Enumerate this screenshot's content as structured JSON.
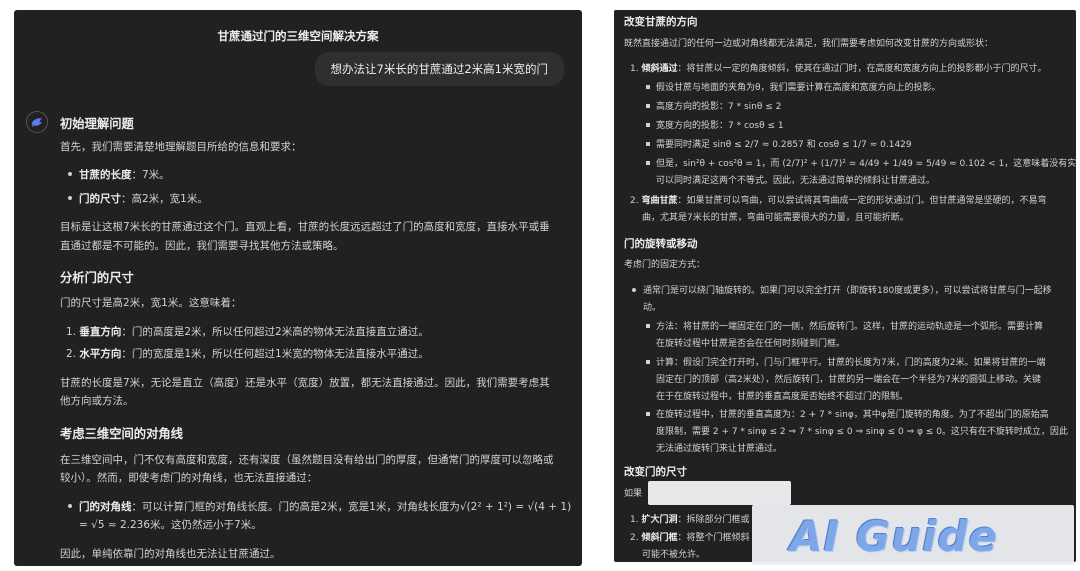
{
  "left": {
    "title": "甘蔗通过门的三维空间解决方案",
    "user_message": "想办法让7米长的甘蔗通过2米高1米宽的门",
    "h1": "初始理解问题",
    "p1": "首先，我们需要清楚地理解题目所给的信息和要求：",
    "b1_label": "甘蔗的长度",
    "b1_text": "：7米。",
    "b2_label": "门的尺寸",
    "b2_text": "：高2米，宽1米。",
    "p2_l1": "目标是让这根7米长的甘蔗通过这个门。直观上看，甘蔗的长度远远超过了门的高度和宽度，直接水平或垂",
    "p2_l2": "直通过都是不可能的。因此，我们需要寻找其他方法或策略。",
    "h2": "分析门的尺寸",
    "p3": "门的尺寸是高2米，宽1米。这意味着：",
    "n1_num": "1.",
    "n1_label": "垂直方向",
    "n1_text": "：门的高度是2米，所以任何超过2米高的物体无法直接直立通过。",
    "n2_num": "2.",
    "n2_label": "水平方向",
    "n2_text": "：门的宽度是1米，所以任何超过1米宽的物体无法直接水平通过。",
    "p4_l1": "甘蔗的长度是7米，无论是直立（高度）还是水平（宽度）放置，都无法直接通过。因此，我们需要考虑其",
    "p4_l2": "他方向或方法。",
    "h3": "考虑三维空间的对角线",
    "p5_l1": "在三维空间中，门不仅有高度和宽度，还有深度（虽然题目没有给出门的厚度，但通常门的厚度可以忽略或",
    "p5_l2": "较小）。然而，即使考虑门的对角线，也无法直接通过：",
    "b3_label": "门的对角线",
    "b3_text": "：可以计算门框的对角线长度。门的高是2米，宽是1米，对角线长度为√(2² + 1²) = √(4 + 1)",
    "b3_l2": "= √5 ≈ 2.236米。这仍然远小于7米。",
    "p6": "因此，单纯依靠门的对角线也无法让甘蔗通过。"
  },
  "right": {
    "h1": "改变甘蔗的方向",
    "p1": "既然直接通过门的任何一边或对角线都无法满足，我们需要考虑如何改变甘蔗的方向或形状：",
    "n1_num": "1.",
    "n1_label": "倾斜通过",
    "n1_text": "：将甘蔗以一定的角度倾斜，使其在通过门时，在高度和宽度方向上的投影都小于门的尺寸。",
    "s1": "假设甘蔗与地面的夹角为θ，我们需要计算在高度和宽度方向上的投影。",
    "s2": "高度方向的投影：7 * sinθ ≤ 2",
    "s3": "宽度方向的投影：7 * cosθ ≤ 1",
    "s4": "需要同时满足 sinθ ≤ 2/7 ≈ 0.2857 和 cosθ ≤ 1/7 ≈ 0.1429",
    "s5_l1": "但是，sin²θ + cos²θ = 1，而 (2/7)² + (1/7)² = 4/49 + 1/49 = 5/49 ≈ 0.102 < 1，这意味着没有实数θ",
    "s5_l2": "可以同时满足这两个不等式。因此，无法通过简单的倾斜让甘蔗通过。",
    "n2_num": "2.",
    "n2_label": "弯曲甘蔗",
    "n2_text": "：如果甘蔗可以弯曲，可以尝试将其弯曲成一定的形状通过门。但甘蔗通常是坚硬的，不易弯",
    "n2_l2": "曲，尤其是7米长的甘蔗，弯曲可能需要很大的力量，且可能折断。",
    "h2": "门的旋转或移动",
    "p2": "考虑门的固定方式：",
    "b1_l1": "通常门是可以绕门轴旋转的。如果门可以完全打开（即旋转180度或更多），可以尝试将甘蔗与门一起移",
    "b1_l2": "动。",
    "m1_l1": "方法：将甘蔗的一端固定在门的一侧，然后旋转门。这样，甘蔗的运动轨迹是一个弧形。需要计算",
    "m1_l2": "在旋转过程中甘蔗是否会在任何时刻碰到门框。",
    "m2_l1": "计算：假设门完全打开时，门与门框平行。甘蔗的长度为7米，门的高度为2米。如果将甘蔗的一端",
    "m2_l2": "固定在门的顶部（高2米处），然后旋转门，甘蔗的另一端会在一个半径为7米的圆弧上移动。关键",
    "m2_l3": "在于在旋转过程中，甘蔗的垂直高度是否始终不超过门的限制。",
    "m3_l1": "在旋转过程中，甘蔗的垂直高度为：2 + 7 * sinφ，其中φ是门旋转的角度。为了不超出门的原始高",
    "m3_l2": "度限制，需要 2 + 7 * sinφ ≤ 2 ⇒ 7 * sinφ ≤ 0 ⇒ sinφ ≤ 0 ⇒ φ ≤ 0。这只有在不旋转时成立，因此",
    "m3_l3": "无法通过旋转门来让甘蔗通过。",
    "h3": "改变门的尺寸",
    "p3": "如果",
    "c1_num": "1.",
    "c1_label": "扩大门洞",
    "c1_text": "：拆除部分门框或",
    "c2_num": "2.",
    "c2_label": "倾斜门框",
    "c2_text": "：将整个门框倾斜",
    "c2_l2": "可能不被允许。"
  },
  "watermark": "AI Guide"
}
